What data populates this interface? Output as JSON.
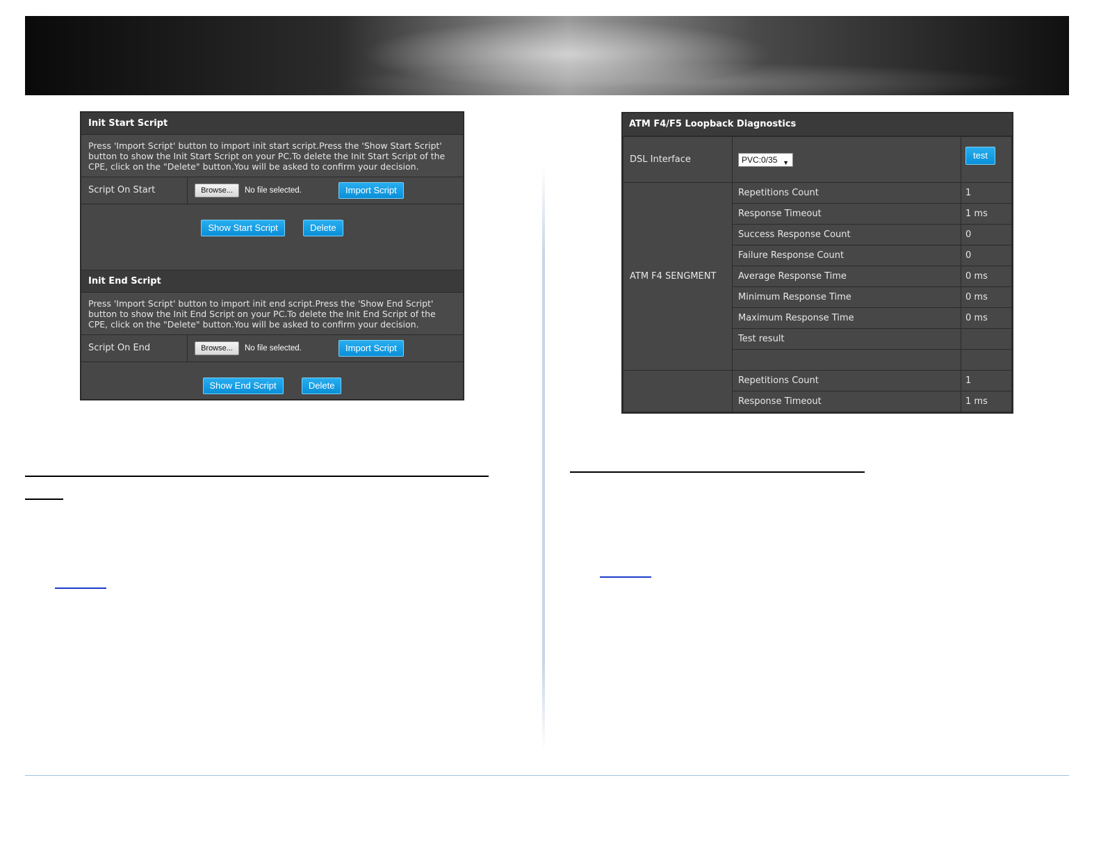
{
  "start_script": {
    "title": "Init Start Script",
    "description": "Press 'Import Script' button to import init start script.Press the 'Show Start Script' button to show the Init Start Script on your PC.To delete the Init Start Script of the CPE, click on the \"Delete\" button.You will be asked to confirm your decision.",
    "row_label": "Script On Start",
    "browse_label": "Browse...",
    "no_file_text": "No file selected.",
    "import_label": "Import Script",
    "show_label": "Show Start Script",
    "delete_label": "Delete"
  },
  "end_script": {
    "title": "Init End Script",
    "description": "Press 'Import Script' button to import init end script.Press the 'Show End Script' button to show the Init End Script on your PC.To delete the Init End Script of the CPE, click on the \"Delete\" button.You will be asked to confirm your decision.",
    "row_label": "Script On End",
    "browse_label": "Browse...",
    "no_file_text": "No file selected.",
    "import_label": "Import Script",
    "show_label": "Show End Script",
    "delete_label": "Delete"
  },
  "atm": {
    "title": "ATM F4/F5 Loopback Diagnostics",
    "dsl_label": "DSL Interface",
    "dsl_value": "PVC:0/35",
    "test_label": "test",
    "f4_segment_label": "ATM F4 SENGMENT",
    "f4_rows": [
      {
        "label": "Repetitions Count",
        "value": "1"
      },
      {
        "label": "Response Timeout",
        "value": "1 ms"
      },
      {
        "label": "Success Response Count",
        "value": "0"
      },
      {
        "label": "Failure Response Count",
        "value": "0"
      },
      {
        "label": "Average Response Time",
        "value": "0 ms"
      },
      {
        "label": "Minimum Response Time",
        "value": "0 ms"
      },
      {
        "label": "Maximum Response Time",
        "value": "0 ms"
      },
      {
        "label": "Test result",
        "value": ""
      },
      {
        "label": "",
        "value": ""
      }
    ],
    "next_rows": [
      {
        "label": "Repetitions Count",
        "value": "1"
      },
      {
        "label": "Response Timeout",
        "value": "1 ms"
      }
    ]
  }
}
